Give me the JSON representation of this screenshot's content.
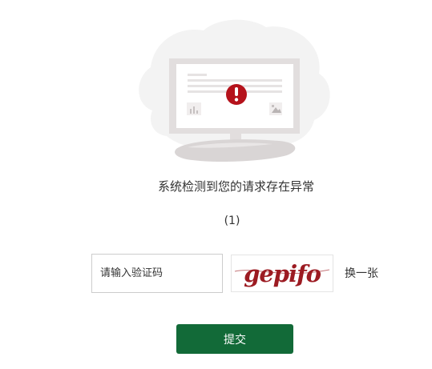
{
  "verification": {
    "message": "系统检测到您的请求存在异常",
    "code_label": "(1)",
    "input_placeholder": "请输入验证码",
    "input_value": "",
    "captcha_text": "gepifo",
    "refresh_label": "换一张",
    "submit_label": "提交"
  },
  "icons": {
    "alert": "exclamation-alert-icon",
    "illustration": "monitor-warning-illustration"
  },
  "colors": {
    "primary_button": "#126a38",
    "alert_red": "#b5121b",
    "captcha_red": "#9c1b22"
  }
}
